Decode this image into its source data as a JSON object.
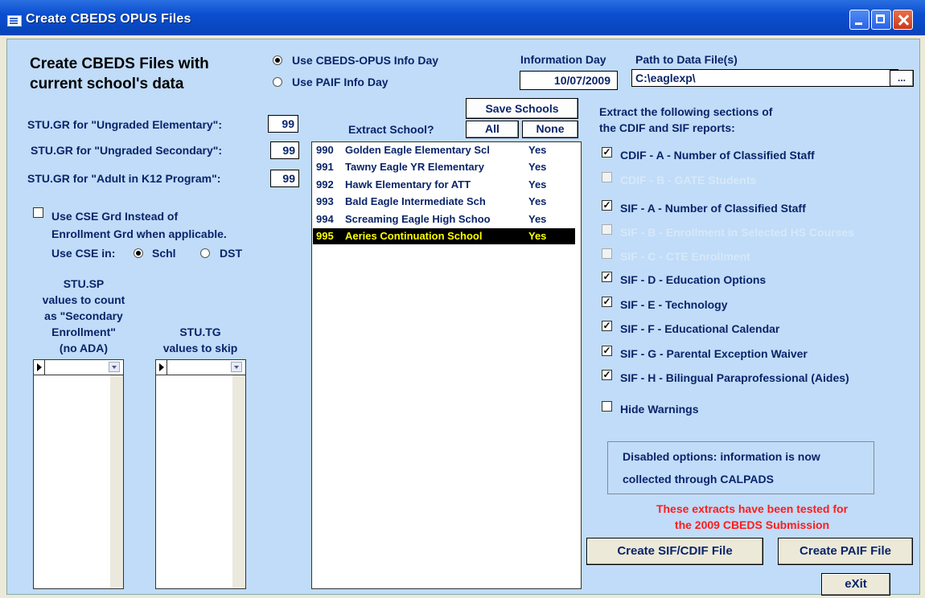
{
  "window": {
    "title": "Create CBEDS OPUS Files"
  },
  "header": {
    "title_line1": "Create CBEDS Files with",
    "title_line2": "current school's data",
    "radio_opus": "Use CBEDS-OPUS Info Day",
    "radio_paif": "Use PAIF Info Day",
    "info_day_label": "Information Day",
    "info_day_value": "10/07/2009",
    "path_label": "Path to Data File(s)",
    "path_value": "C:\\eaglexp\\",
    "browse_label": "..."
  },
  "grades": [
    {
      "label": "STU.GR for \"Ungraded Elementary\":",
      "value": "99"
    },
    {
      "label": "STU.GR for \"Ungraded Secondary\":",
      "value": "99"
    },
    {
      "label": "STU.GR for \"Adult in K12 Program\":",
      "value": "99"
    }
  ],
  "cse": {
    "line1": "Use CSE Grd Instead of",
    "line2": "Enrollment Grd when applicable.",
    "use_in": "Use CSE in:",
    "opt_schl": "Schl",
    "opt_dst": "DST"
  },
  "sp_list": {
    "l1": "STU.SP",
    "l2": "values to count",
    "l3": "as \"Secondary",
    "l4": "Enrollment\"",
    "l5": "(no ADA)"
  },
  "tg_list": {
    "l1": "STU.TG",
    "l2": "values to skip"
  },
  "schools": {
    "save_label": "Save Schools",
    "extract_label": "Extract School?",
    "all_label": "All",
    "none_label": "None",
    "rows": [
      {
        "code": "990",
        "name": "Golden Eagle Elementary Scl",
        "extract": "Yes"
      },
      {
        "code": "991",
        "name": "Tawny Eagle YR Elementary",
        "extract": "Yes"
      },
      {
        "code": "992",
        "name": "Hawk Elementary for ATT",
        "extract": "Yes"
      },
      {
        "code": "993",
        "name": "Bald Eagle Intermediate Sch",
        "extract": "Yes"
      },
      {
        "code": "994",
        "name": "Screaming Eagle High Schoo",
        "extract": "Yes"
      },
      {
        "code": "995",
        "name": "Aeries Continuation School",
        "extract": "Yes"
      }
    ]
  },
  "extract": {
    "heading1": "Extract the following sections of",
    "heading2": "the CDIF and SIF reports:",
    "options": [
      {
        "label": "CDIF - A - Number of Classified Staff",
        "checked": true,
        "enabled": true
      },
      {
        "label": "CDIF - B - GATE Students",
        "checked": false,
        "enabled": false
      },
      {
        "label": "SIF - A - Number of Classified Staff",
        "checked": true,
        "enabled": true
      },
      {
        "label": "SIF - B - Enrollment in Selected HS Courses",
        "checked": false,
        "enabled": false
      },
      {
        "label": "SIF - C - CTE Enrollment",
        "checked": false,
        "enabled": false
      },
      {
        "label": "SIF - D - Education Options",
        "checked": true,
        "enabled": true
      },
      {
        "label": "SIF - E - Technology",
        "checked": true,
        "enabled": true
      },
      {
        "label": "SIF - F - Educational Calendar",
        "checked": true,
        "enabled": true
      },
      {
        "label": "SIF - G - Parental Exception Waiver",
        "checked": true,
        "enabled": true
      },
      {
        "label": "SIF - H - Bilingual Paraprofessional (Aides)",
        "checked": true,
        "enabled": true
      }
    ],
    "hide_warnings": "Hide Warnings",
    "note_line1": "Disabled options: information is now",
    "note_line2": "collected through CALPADS",
    "tested_line1": "These extracts have been tested for",
    "tested_line2": "the 2009 CBEDS Submission"
  },
  "buttons": {
    "create_sif": "Create SIF/CDIF File",
    "create_paif": "Create PAIF File",
    "exit": "eXit"
  }
}
